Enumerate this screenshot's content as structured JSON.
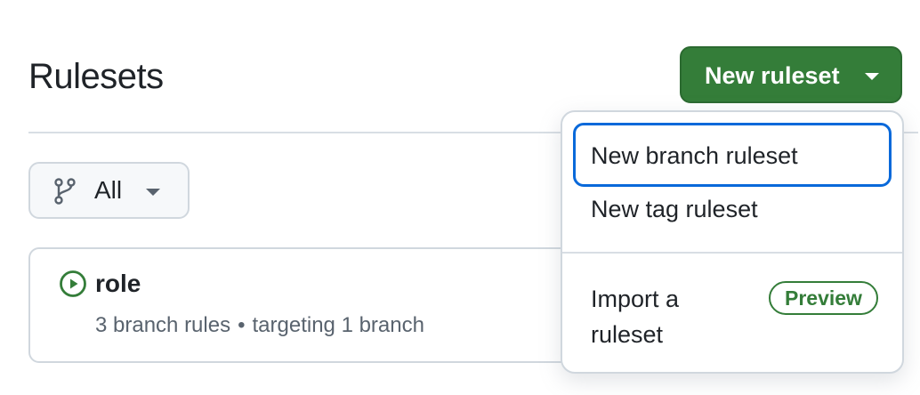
{
  "page": {
    "title": "Rulesets"
  },
  "new_ruleset_button": {
    "label": "New ruleset",
    "color": "#347d39"
  },
  "filter": {
    "selected": "All",
    "icon": "git-branch-icon"
  },
  "rulesets": [
    {
      "name": "role",
      "status_icon": "play-circle-icon",
      "status_color": "#347d39",
      "rules_text": "3 branch rules",
      "separator": "•",
      "target_text": "targeting 1 branch"
    }
  ],
  "dropdown": {
    "items": [
      {
        "label": "New branch ruleset"
      },
      {
        "label": "New tag ruleset"
      },
      {
        "label": "Import a ruleset",
        "badge": "Preview"
      }
    ]
  }
}
